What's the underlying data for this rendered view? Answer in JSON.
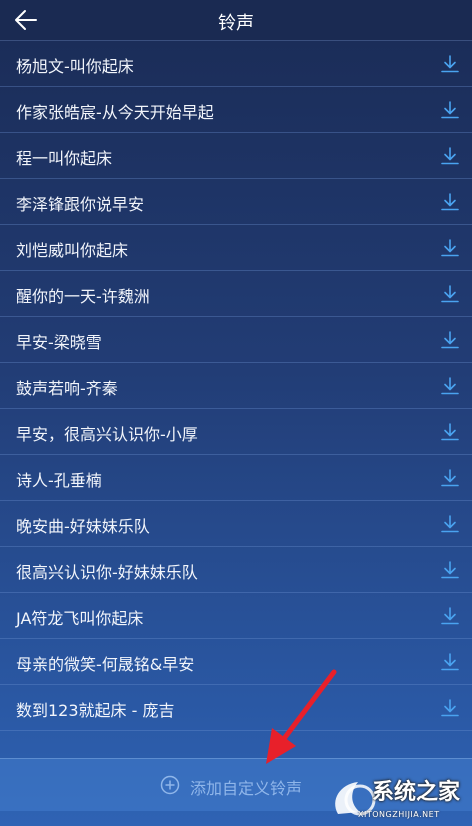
{
  "header": {
    "title": "铃声",
    "back_icon": "back-arrow-icon"
  },
  "ringtones": [
    "杨旭文-叫你起床",
    "作家张皓宸-从今天开始早起",
    "程一叫你起床",
    "李泽锋跟你说早安",
    "刘恺威叫你起床",
    "醒你的一天-许魏洲",
    "早安-梁晓雪",
    "鼓声若响-齐秦",
    "早安，很高兴认识你-小厚",
    "诗人-孔垂楠",
    "晚安曲-好妹妹乐队",
    "很高兴认识你-好妹妹乐队",
    "JA符龙飞叫你起床",
    "母亲的微笑-何晟铭&早安",
    "数到123就起床 - 庞吉"
  ],
  "download_icon": "download-icon",
  "footer": {
    "add_label": "添加自定义铃声",
    "add_icon": "plus-circle-icon"
  },
  "watermark": {
    "text": "系统之家",
    "url": "XITONGZHIJIA.NET"
  },
  "colors": {
    "accent": "#4aa3f0",
    "header_bg": "#1a2a52",
    "annotation_arrow": "#e8202a"
  }
}
